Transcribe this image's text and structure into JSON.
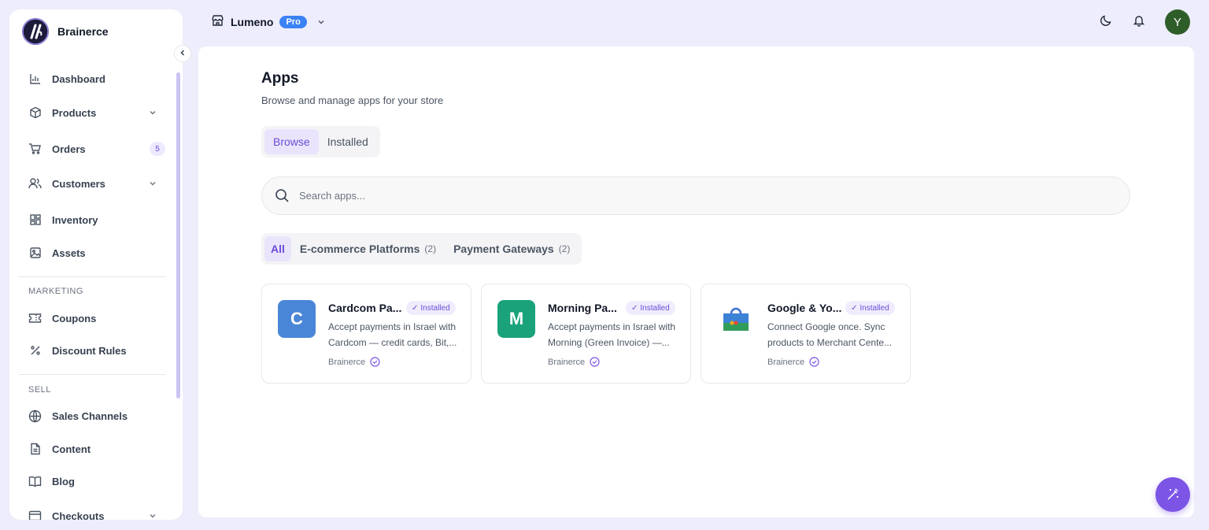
{
  "brand": {
    "name": "Brainerce"
  },
  "store": {
    "name": "Lumeno",
    "plan": "Pro"
  },
  "user": {
    "initial": "Y"
  },
  "sidebar": {
    "items": [
      {
        "label": "Dashboard",
        "icon": "bar-chart-icon"
      },
      {
        "label": "Products",
        "icon": "box-icon",
        "expandable": true
      },
      {
        "label": "Orders",
        "icon": "cart-icon",
        "badge": "5"
      },
      {
        "label": "Customers",
        "icon": "users-icon",
        "expandable": true
      },
      {
        "label": "Inventory",
        "icon": "grid-icon"
      },
      {
        "label": "Assets",
        "icon": "image-icon"
      }
    ],
    "marketing_label": "MARKETING",
    "marketing": [
      {
        "label": "Coupons",
        "icon": "ticket-icon"
      },
      {
        "label": "Discount Rules",
        "icon": "percent-icon"
      }
    ],
    "sell_label": "SELL",
    "sell": [
      {
        "label": "Sales Channels",
        "icon": "globe-icon"
      },
      {
        "label": "Content",
        "icon": "file-icon"
      },
      {
        "label": "Blog",
        "icon": "book-icon"
      },
      {
        "label": "Checkouts",
        "icon": "card-icon",
        "expandable": true
      }
    ]
  },
  "page": {
    "title": "Apps",
    "subtitle": "Browse and manage apps for your store",
    "tabs": [
      {
        "label": "Browse",
        "active": true
      },
      {
        "label": "Installed",
        "active": false
      }
    ],
    "search": {
      "placeholder": "Search apps..."
    },
    "filters": [
      {
        "label": "All",
        "count": "",
        "active": true
      },
      {
        "label": "E-commerce Platforms",
        "count": "(2)",
        "active": false
      },
      {
        "label": "Payment Gateways",
        "count": "(2)",
        "active": false
      }
    ]
  },
  "apps": [
    {
      "name": "Cardcom Pa...",
      "letter": "C",
      "color": "#4a86d8",
      "installed_label": "Installed",
      "desc_line1": "Accept payments in Israel with",
      "desc_line2": "Cardcom — credit cards, Bit,...",
      "vendor": "Brainerce"
    },
    {
      "name": "Morning Pa...",
      "letter": "M",
      "color": "#1aa37a",
      "installed_label": "Installed",
      "desc_line1": "Accept payments in Israel with",
      "desc_line2": "Morning (Green Invoice) —...",
      "vendor": "Brainerce"
    },
    {
      "name": "Google & Yo...",
      "letter": "",
      "color": "#ffffff",
      "installed_label": "Installed",
      "desc_line1": "Connect Google once. Sync",
      "desc_line2": "products to Merchant Cente...",
      "vendor": "Brainerce"
    }
  ],
  "colors": {
    "accent": "#6d4bd6",
    "fab": "#7c55e6",
    "pro": "#3b82f6"
  }
}
